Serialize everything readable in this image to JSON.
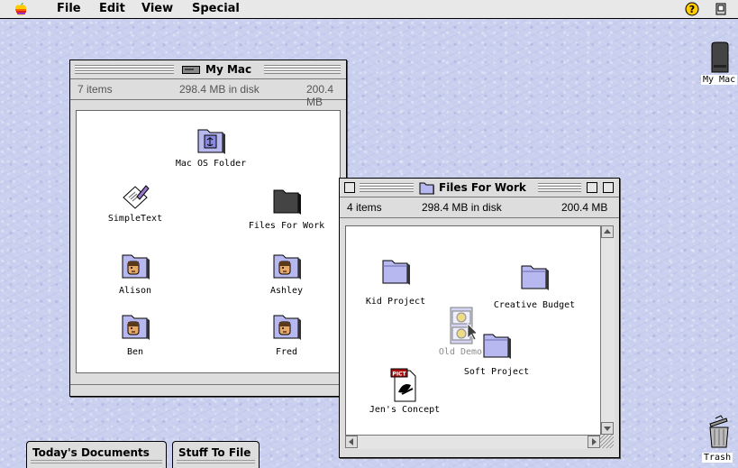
{
  "menubar": {
    "items": [
      "File",
      "Edit",
      "View",
      "Special"
    ],
    "apple_icon": "apple-icon",
    "help_icon": "help-icon",
    "app_icon": "application-menu-icon"
  },
  "window_mymac": {
    "title": "My Mac",
    "info": {
      "items": "7 items",
      "disk": "298.4 MB in disk",
      "available": "200.4 MB"
    },
    "icons": [
      {
        "label": "Mac OS Folder",
        "icon": "system-folder-icon"
      },
      {
        "label": "SimpleText",
        "icon": "simpletext-app-icon"
      },
      {
        "label": "Files For Work",
        "icon": "folder-open-icon"
      },
      {
        "label": "Alison",
        "icon": "user-folder-icon"
      },
      {
        "label": "Ashley",
        "icon": "user-folder-icon"
      },
      {
        "label": "Ben",
        "icon": "user-folder-icon"
      },
      {
        "label": "Fred",
        "icon": "user-folder-icon"
      }
    ]
  },
  "window_files": {
    "title": "Files For Work",
    "info": {
      "items": "4 items",
      "disk": "298.4 MB in disk",
      "available": "200.4 MB"
    },
    "icons": [
      {
        "label": "Kid Project",
        "icon": "folder-icon"
      },
      {
        "label": "Creative Budget",
        "icon": "folder-icon"
      },
      {
        "label": "Old Demo",
        "icon": "movie-file-icon"
      },
      {
        "label": "Soft Project",
        "icon": "folder-icon"
      },
      {
        "label": "Jen's Concept",
        "icon": "pict-file-icon",
        "badge": "PICT"
      }
    ]
  },
  "desktop": {
    "my_mac": "My Mac",
    "trash": "Trash"
  },
  "tabs": [
    "Today's Documents",
    "Stuff To File"
  ],
  "colors": {
    "folder": "#b8b8f0",
    "desktop": "#c9cfee",
    "chrome": "#dddddd"
  }
}
